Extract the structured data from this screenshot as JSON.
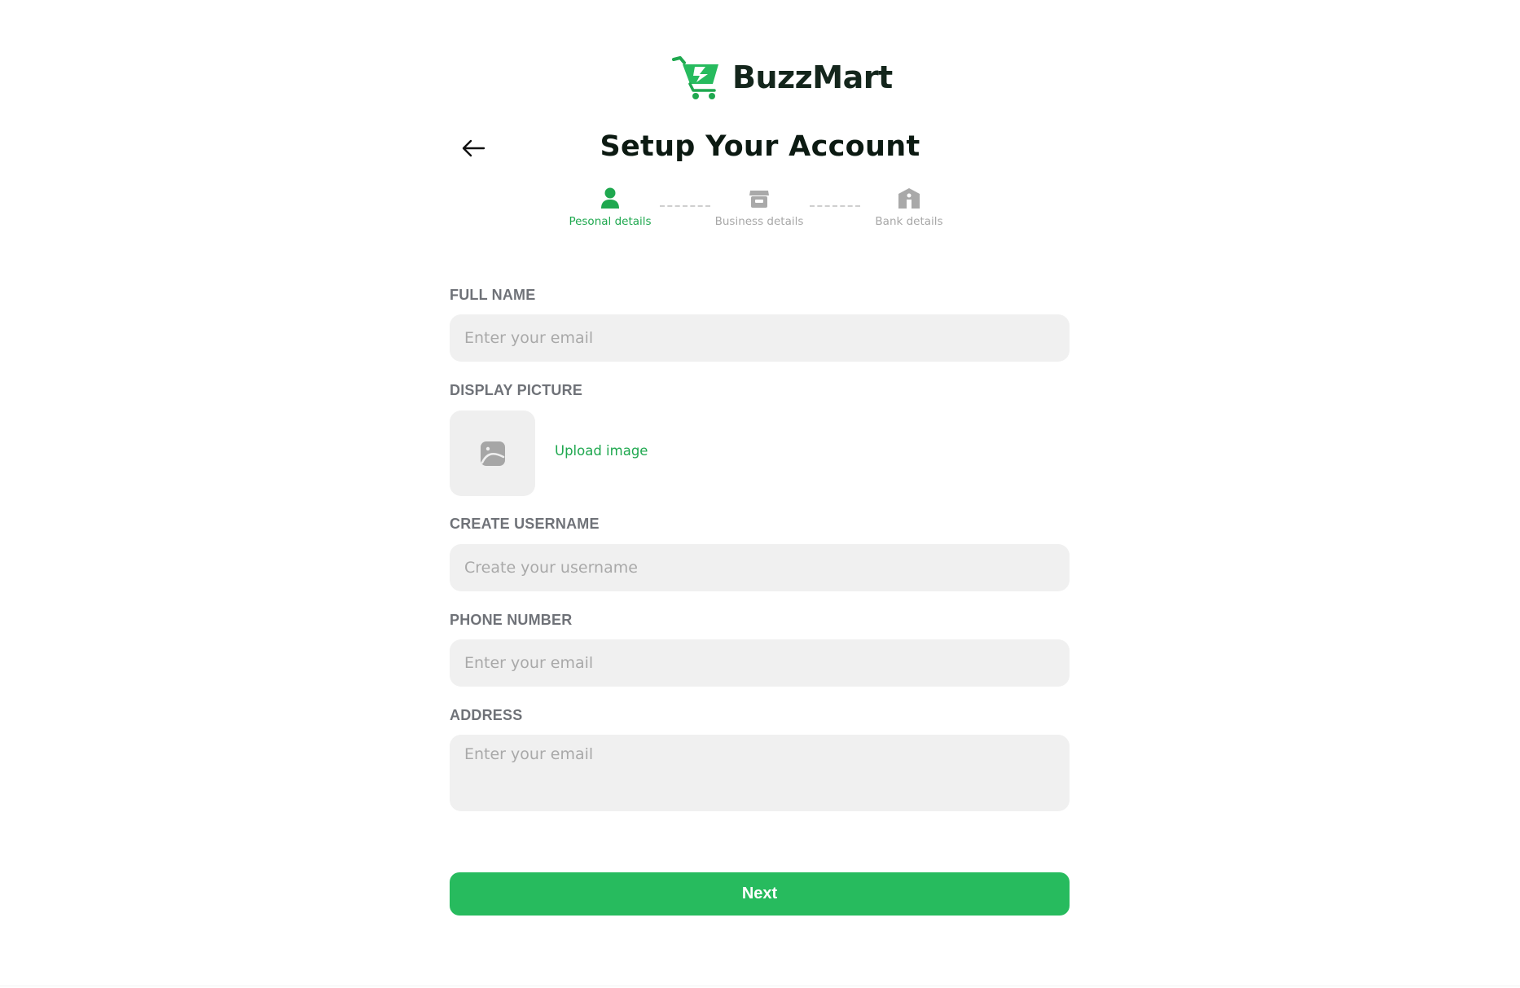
{
  "brand": {
    "name": "BuzzMart",
    "logo_icon": "shopping-cart-icon",
    "accent_color": "#27bb5e",
    "accent_text_color": "#1fa84f"
  },
  "header": {
    "title": "Setup Your Account",
    "back_icon": "arrow-left-icon"
  },
  "steps": [
    {
      "label": "Pesonal details",
      "icon": "user-icon",
      "state": "active"
    },
    {
      "label": "Business details",
      "icon": "store-icon",
      "state": "inactive"
    },
    {
      "label": "Bank details",
      "icon": "bank-icon",
      "state": "inactive"
    }
  ],
  "form": {
    "full_name": {
      "label": "FULL NAME",
      "placeholder": "Enter your email",
      "value": ""
    },
    "display_picture": {
      "label": "DISPLAY PICTURE",
      "upload_label": "Upload image",
      "icon": "image-icon"
    },
    "username": {
      "label": "CREATE USERNAME",
      "placeholder": "Create your username",
      "value": ""
    },
    "phone": {
      "label": "PHONE NUMBER",
      "placeholder": "Enter your email",
      "value": ""
    },
    "address": {
      "label": "ADDRESS",
      "placeholder": "Enter your email",
      "value": ""
    }
  },
  "actions": {
    "next_label": "Next"
  }
}
